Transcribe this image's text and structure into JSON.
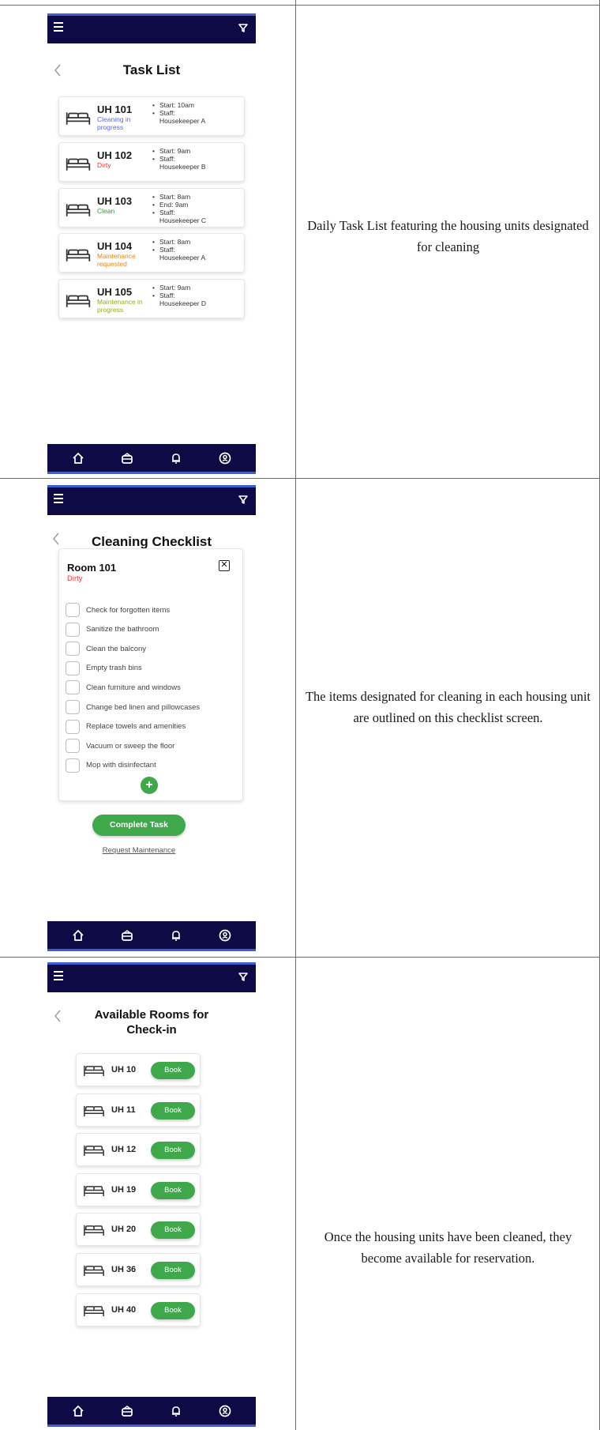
{
  "captions": [
    "Daily Task List featuring the housing units designated for cleaning",
    "The items designated for cleaning in each housing unit are outlined on this checklist screen.",
    "Once the housing units have been cleaned, they become available for reservation."
  ],
  "task_list": {
    "title": "Task List",
    "tasks": [
      {
        "unit": "UH 101",
        "status": "Cleaning in progress",
        "status_color": "#5b6bd6",
        "lines": [
          "Start: 10am",
          "Staff:"
        ],
        "staff": "Housekeeper A"
      },
      {
        "unit": "UH 102",
        "status": "Dirty",
        "status_color": "#e53935",
        "lines": [
          "Start: 9am",
          "Staff:"
        ],
        "staff": "Housekeeper B"
      },
      {
        "unit": "UH 103",
        "status": "Clean",
        "status_color": "#2e9e3a",
        "lines": [
          "Start: 8am",
          "End: 9am",
          "Staff:"
        ],
        "staff": "Housekeeper C"
      },
      {
        "unit": "UH 104",
        "status": "Maintenance requested",
        "status_color": "#e08a16",
        "lines": [
          "Start: 8am",
          "Staff:"
        ],
        "staff": "Housekeeper A"
      },
      {
        "unit": "UH 105",
        "status": "Maintenance in progress",
        "status_color": "#9aaa1a",
        "lines": [
          "Start: 9am",
          "Staff:"
        ],
        "staff": "Housekeeper D"
      }
    ]
  },
  "checklist": {
    "title": "Cleaning Checklist",
    "room": "Room 101",
    "room_status": "Dirty",
    "close_glyph": "✕",
    "items": [
      "Check for forgotten items",
      "Sanitize the bathroom",
      "Clean the balcony",
      "Empty trash bins",
      "Clean furniture and windows",
      "Change bed linen and pillowcases",
      "Replace towels and amenities",
      "Vacuum or sweep the floor",
      "Mop with disinfectant"
    ],
    "add_glyph": "+",
    "complete_label": "Complete Task",
    "maintenance_label": "Request Maintenance"
  },
  "available": {
    "title_line1": "Available Rooms for",
    "title_line2": "Check-in",
    "book_label": "Book",
    "rooms": [
      "UH 10",
      "UH 11",
      "UH 12",
      "UH 19",
      "UH 20",
      "UH 36",
      "UH 40"
    ]
  },
  "icons": {
    "top_left": "menu-icon",
    "top_right": "filter-icon",
    "nav": [
      "home-icon",
      "rooms-icon",
      "bell-icon",
      "profile-icon"
    ]
  },
  "colors": {
    "bar": "#0e0a45",
    "accent": "#3d5fd6",
    "button": "#3ea84a",
    "dirty": "#e53935"
  }
}
